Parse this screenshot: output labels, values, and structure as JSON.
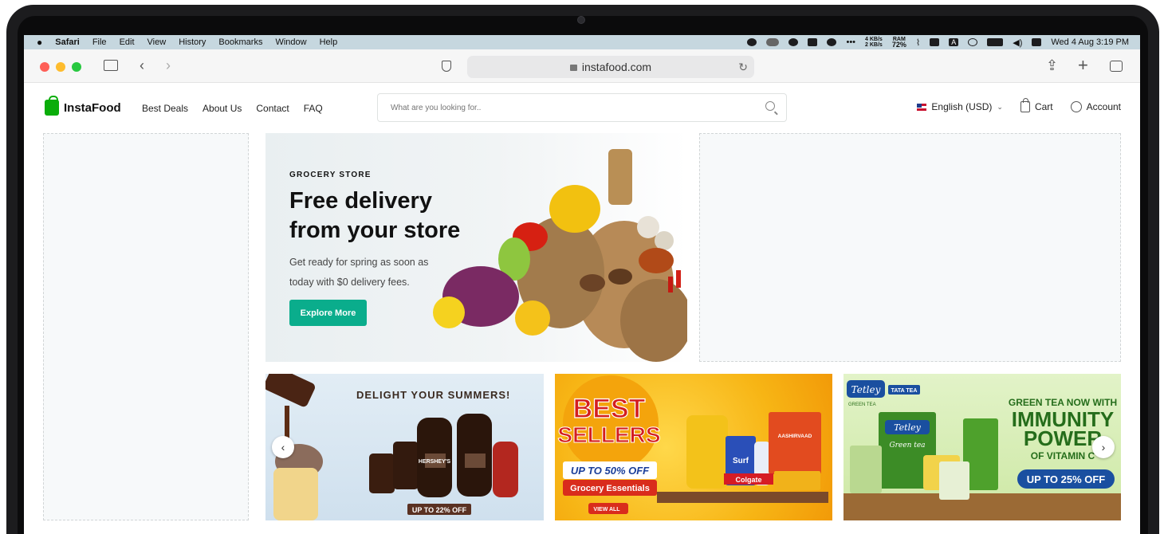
{
  "menubar": {
    "app": "Safari",
    "menus": [
      "File",
      "Edit",
      "View",
      "History",
      "Bookmarks",
      "Window",
      "Help"
    ],
    "net_up": "4 KB/s",
    "net_down": "2 KB/s",
    "ram_label": "RAM",
    "ram_value": "72%",
    "keyboard": "A",
    "datetime": "Wed 4 Aug  3:19 PM"
  },
  "browser": {
    "url": "instafood.com"
  },
  "site": {
    "brand": "InstaFood",
    "nav": [
      "Best Deals",
      "About Us",
      "Contact",
      "FAQ"
    ],
    "search_placeholder": "What are you looking for..",
    "language": "English (USD)",
    "cart": "Cart",
    "account": "Account"
  },
  "hero": {
    "kicker": "GROCERY STORE",
    "title_line1": "Free delivery",
    "title_line2": "from your store",
    "text": "Get ready for spring as soon as today with $0 delivery fees.",
    "button": "Explore More"
  },
  "banners": {
    "b1_title": "DELIGHT YOUR SUMMERS!",
    "b1_offer": "UP TO 22% OFF",
    "b1_product": "HERSHEY'S",
    "b2_title1": "BEST",
    "b2_title2": "SELLERS",
    "b2_offer": "UP TO 50% OFF",
    "b2_sub": "Grocery Essentials",
    "b2_cta": "VIEW ALL",
    "b2_brand1": "Surf",
    "b2_brand2": "Colgate",
    "b2_brand3": "AASHIRVAAD",
    "b3_brand": "Tetley",
    "b3_brand2": "TATA TEA",
    "b3_green": "GREEN TEA",
    "b3_line1": "GREEN TEA NOW WITH",
    "b3_line2": "IMMUNITY",
    "b3_line3": "POWER",
    "b3_line4": "OF VITAMIN C",
    "b3_offer": "UP TO 25% OFF",
    "b3_pack": "Green tea"
  },
  "colors": {
    "accent": "#0aad8c",
    "brand": "#0aad0a"
  }
}
